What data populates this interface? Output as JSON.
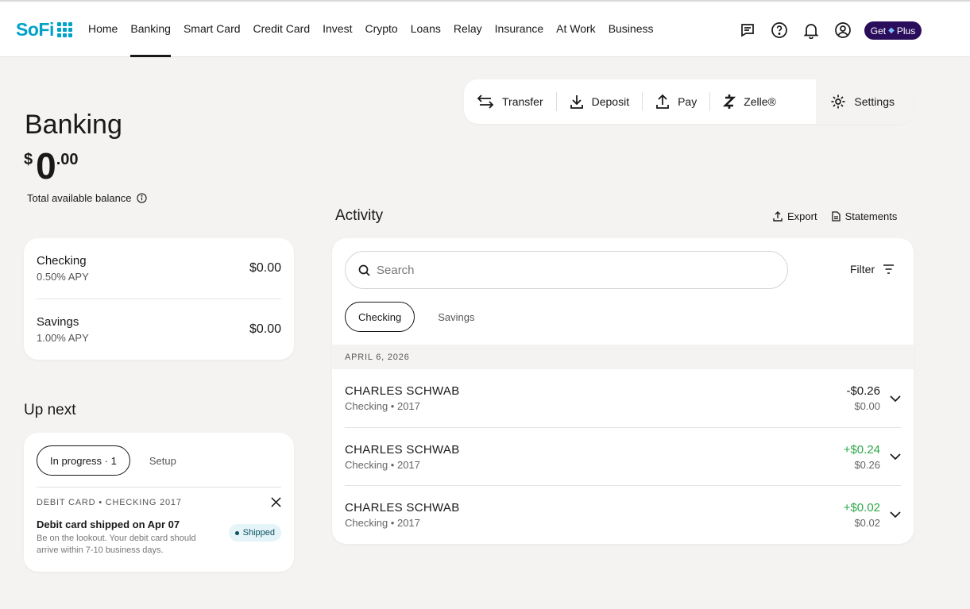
{
  "brand": {
    "name": "SoFi",
    "accent": "#00a2c7"
  },
  "nav": {
    "items": [
      "Home",
      "Banking",
      "Smart Card",
      "Credit Card",
      "Invest",
      "Crypto",
      "Loans",
      "Relay",
      "Insurance",
      "At Work",
      "Business"
    ],
    "active": "Banking",
    "icons": [
      "chat-icon",
      "help-icon",
      "bell-icon",
      "profile-icon"
    ],
    "plus_get": "Get",
    "plus_label": "Plus"
  },
  "actions": {
    "transfer": "Transfer",
    "deposit": "Deposit",
    "pay": "Pay",
    "zelle": "Zelle®",
    "settings": "Settings"
  },
  "page": {
    "title": "Banking",
    "balance_currency": "$",
    "balance_whole": "0",
    "balance_cents": ".00",
    "balance_label": "Total available balance"
  },
  "accounts": [
    {
      "name": "Checking",
      "apy": "0.50% APY",
      "amount": "$0.00"
    },
    {
      "name": "Savings",
      "apy": "1.00% APY",
      "amount": "$0.00"
    }
  ],
  "up_next": {
    "title": "Up next",
    "tabs": [
      "In progress · 1",
      "Setup"
    ],
    "item_header": "DEBIT CARD • CHECKING 2017",
    "item_title": "Debit card shipped on Apr 07",
    "item_desc": "Be on the lookout. Your debit card should arrive within 7-10 business days.",
    "badge": "Shipped"
  },
  "activity": {
    "title": "Activity",
    "export": "Export",
    "statements": "Statements",
    "search_placeholder": "Search",
    "filter": "Filter",
    "tabs": [
      "Checking",
      "Savings"
    ],
    "date": "APRIL 6, 2026",
    "transactions": [
      {
        "name": "CHARLES SCHWAB",
        "sub": "Checking • 2017",
        "amount": "-$0.26",
        "balance": "$0.00",
        "positive": false
      },
      {
        "name": "CHARLES SCHWAB",
        "sub": "Checking • 2017",
        "amount": "+$0.24",
        "balance": "$0.26",
        "positive": true
      },
      {
        "name": "CHARLES SCHWAB",
        "sub": "Checking • 2017",
        "amount": "+$0.02",
        "balance": "$0.02",
        "positive": true
      }
    ]
  }
}
